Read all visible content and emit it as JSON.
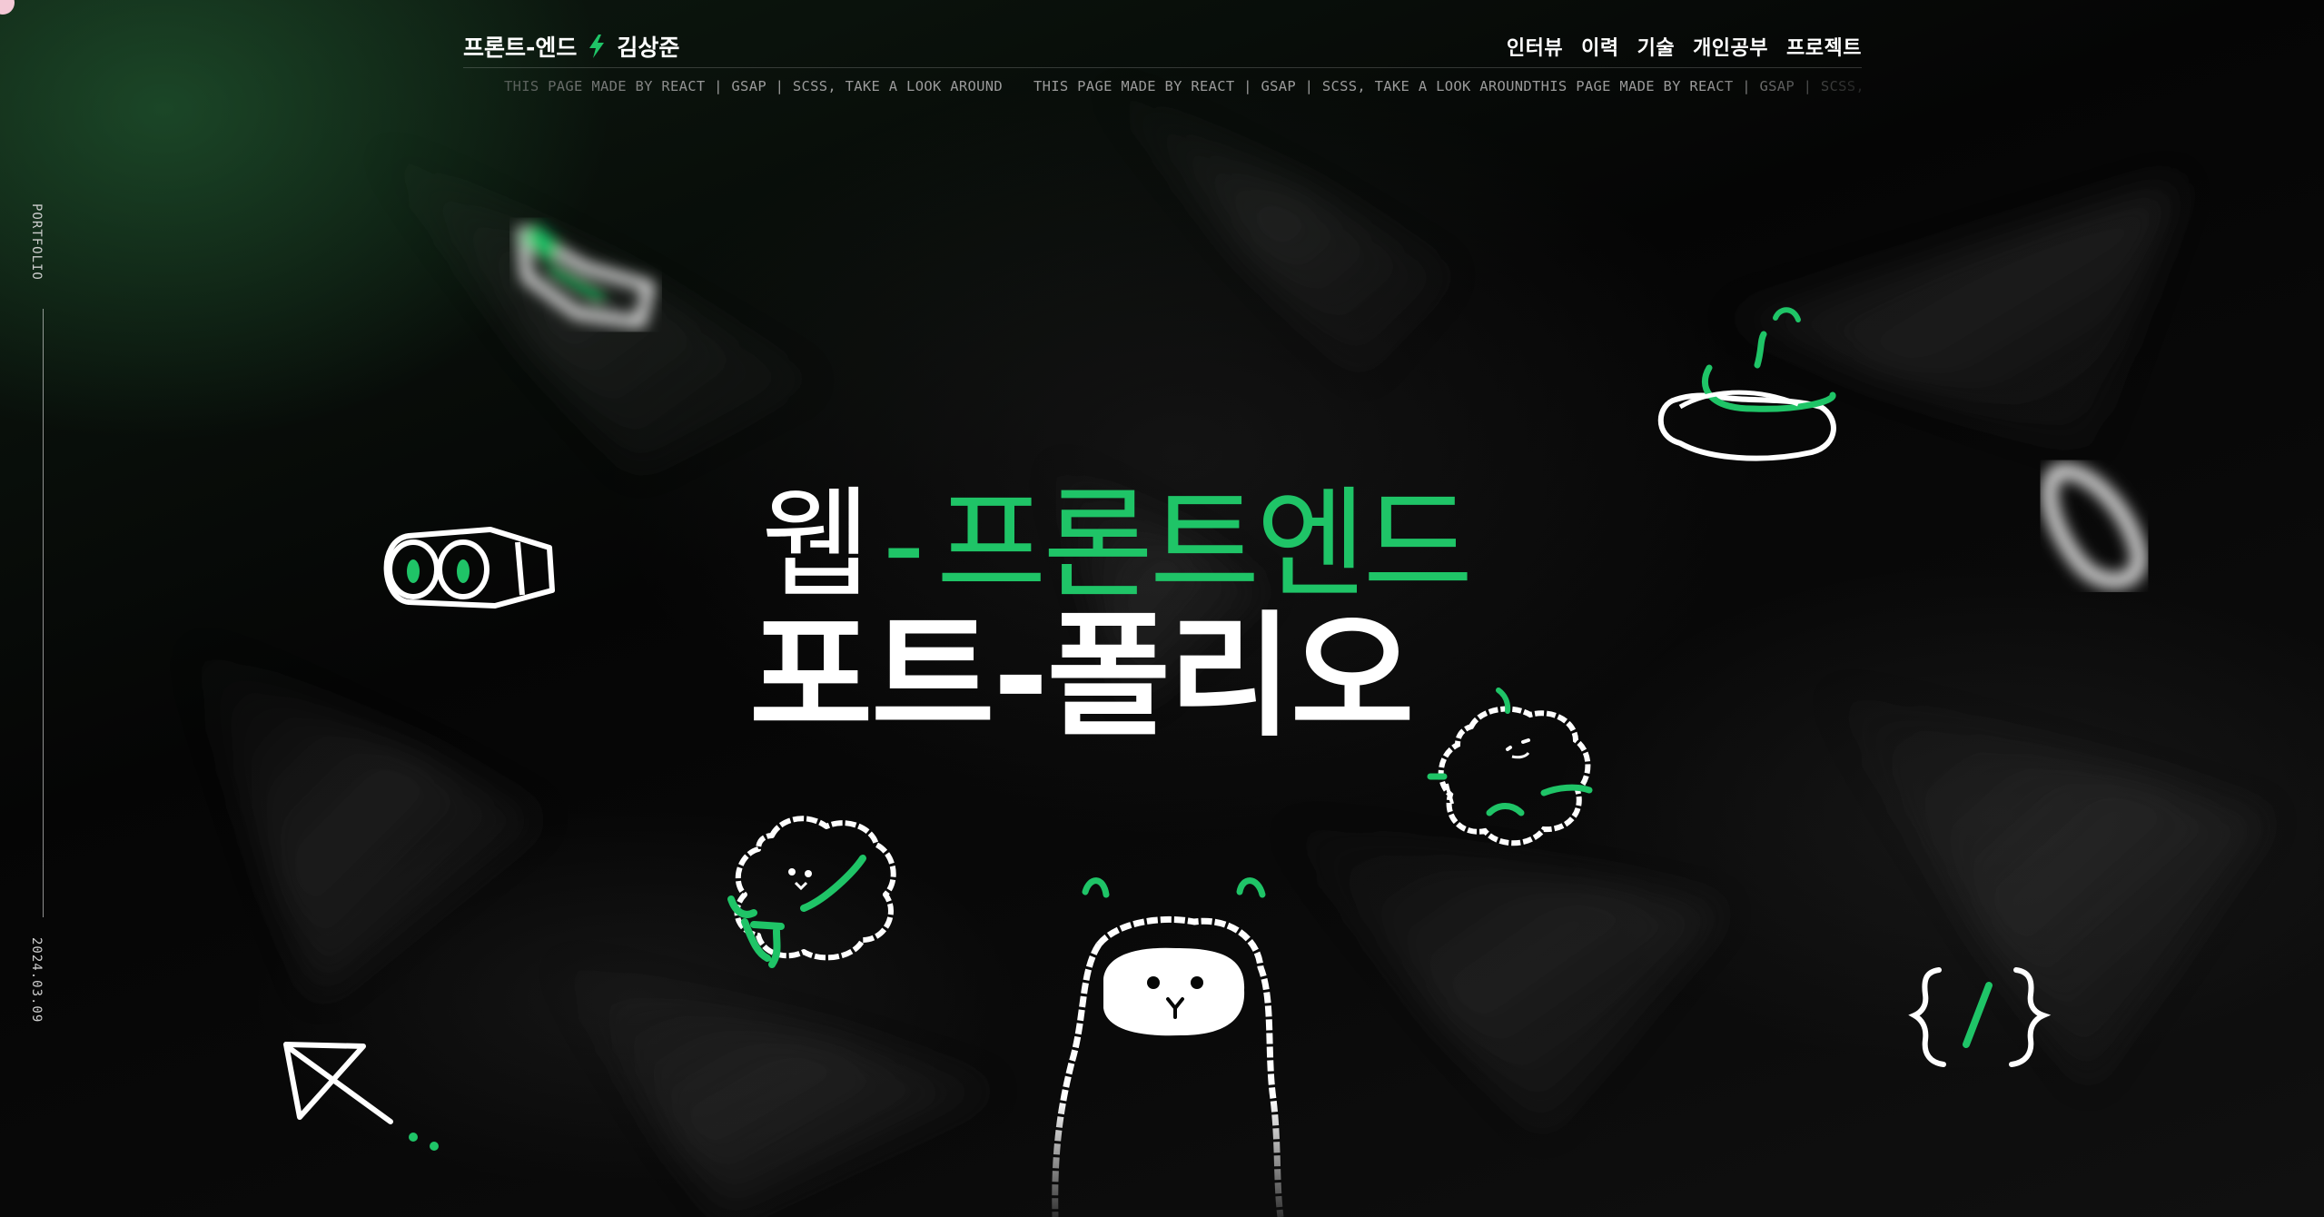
{
  "header": {
    "logo_left": "프론트-엔드",
    "logo_right": "김상준",
    "nav": [
      "인터뷰",
      "이력",
      "기술",
      "개인공부",
      "프로젝트"
    ]
  },
  "marquee": {
    "items": [
      "THIS PAGE MADE BY REACT | GSAP | SCSS, TAKE A LOOK AROUND",
      "THIS PAGE MADE BY REACT | GSAP | SCSS, TAKE A LOOK AROUND",
      "THIS PAGE MADE BY REACT | GSAP | SCSS, TAKE A LOOK AROUND"
    ]
  },
  "rail": {
    "top": "PORTFOLIO",
    "bottom": "2024.03.09"
  },
  "hero": {
    "line1_white": "웹",
    "line1_green": "-프론트엔드",
    "line2": "포트-폴리오"
  },
  "colors": {
    "accent": "#1fc467",
    "text": "#ffffff",
    "background": "#060706"
  },
  "icons": [
    "bolt-icon",
    "binoculars-doodle",
    "witch-hat-doodle",
    "sheep-doodle",
    "fluffy-ghost-doodle",
    "alpaca-doodle",
    "code-brackets-doodle",
    "paper-plane-doodle",
    "leaf-doodle",
    "ring-doodle"
  ]
}
